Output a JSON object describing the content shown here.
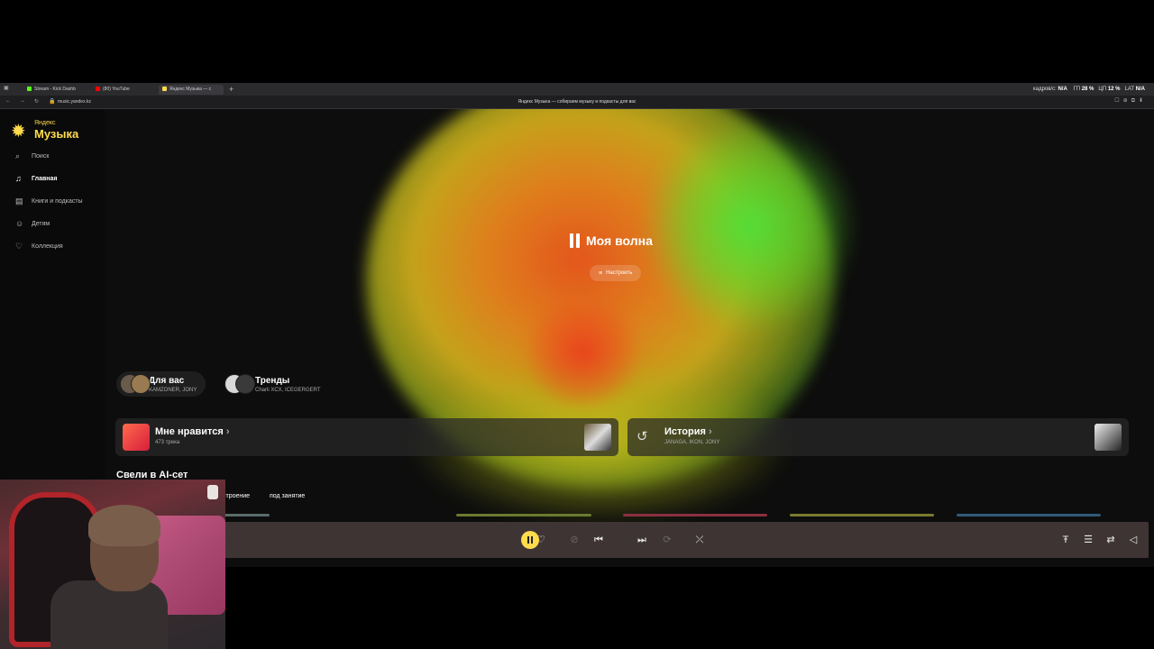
{
  "browser": {
    "tabs": [
      {
        "label": "Stream - Kick Dashb",
        "color": "#53fc18"
      },
      {
        "label": "(80) YouTube",
        "color": "#ff0000"
      },
      {
        "label": "Яндекс Музыка — с",
        "color": "#ffdb4d"
      }
    ],
    "new_tab": "+",
    "url": "music.yandex.kz",
    "page_title": "Яндекс Музыка — собираем музыку и подкасты для вас",
    "stats": {
      "fps_label": "кадров/с:",
      "fps_value": "N/A",
      "cpu_label": "ГП",
      "cpu_value": "28 %",
      "gpu_label": "ЦП",
      "gpu_value": "12 %",
      "lat_label": "LAT",
      "lat_value": "N/A"
    }
  },
  "logo": {
    "top": "Яндекс",
    "main": "Музыка"
  },
  "sidebar": {
    "items": [
      {
        "label": "Поиск",
        "icon": "search-icon"
      },
      {
        "label": "Главная",
        "icon": "music-note-icon"
      },
      {
        "label": "Книги и подкасты",
        "icon": "book-icon"
      },
      {
        "label": "Детям",
        "icon": "kids-icon"
      },
      {
        "label": "Коллекция",
        "icon": "heart-icon"
      }
    ]
  },
  "wave": {
    "title": "Моя волна",
    "tune_label": "Настроить"
  },
  "mixes": [
    {
      "name": "Для вас",
      "sub": "KAMZONER, JONY"
    },
    {
      "name": "Тренды",
      "sub": "Charli XCX, ICEGERGERT"
    }
  ],
  "cards": {
    "liked": {
      "title": "Мне нравится",
      "sub": "473 трека"
    },
    "history": {
      "title": "История",
      "sub": "JANAGA, IKON, JONY"
    }
  },
  "section": {
    "title": "Свели в AI-сет",
    "chips": [
      "строение",
      "под занятие"
    ]
  },
  "colors": {
    "accent": "#ffdb4d",
    "player_bg": "#3e3434",
    "liked_red": "#d61e3b"
  },
  "player": {
    "state": "playing"
  }
}
